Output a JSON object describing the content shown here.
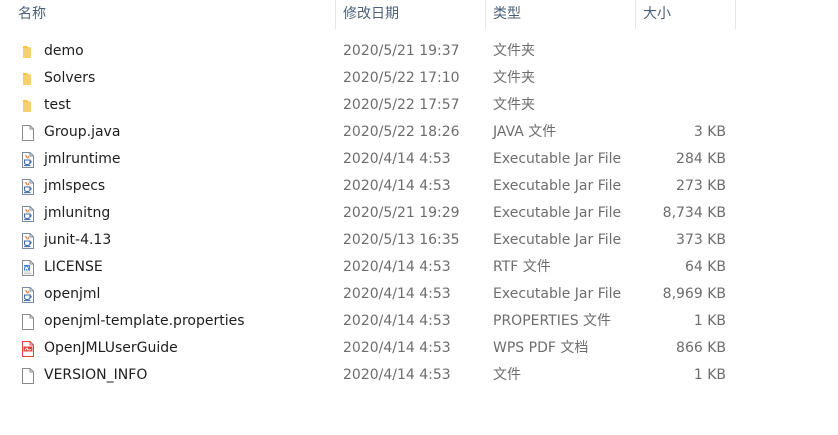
{
  "columns": {
    "name": "名称",
    "date": "修改日期",
    "type": "类型",
    "size": "大小"
  },
  "sort_indicator": "^",
  "files": [
    {
      "name": "demo",
      "date": "2020/5/21 19:37",
      "type": "文件夹",
      "size": "",
      "icon": "folder-icon"
    },
    {
      "name": "Solvers",
      "date": "2020/5/22 17:10",
      "type": "文件夹",
      "size": "",
      "icon": "folder-icon"
    },
    {
      "name": "test",
      "date": "2020/5/22 17:57",
      "type": "文件夹",
      "size": "",
      "icon": "folder-icon"
    },
    {
      "name": "Group.java",
      "date": "2020/5/22 18:26",
      "type": "JAVA 文件",
      "size": "3 KB",
      "icon": "blank-file-icon"
    },
    {
      "name": "jmlruntime",
      "date": "2020/4/14 4:53",
      "type": "Executable Jar File",
      "size": "284 KB",
      "icon": "java-jar-icon"
    },
    {
      "name": "jmlspecs",
      "date": "2020/4/14 4:53",
      "type": "Executable Jar File",
      "size": "273 KB",
      "icon": "java-jar-icon"
    },
    {
      "name": "jmlunitng",
      "date": "2020/5/21 19:29",
      "type": "Executable Jar File",
      "size": "8,734 KB",
      "icon": "java-jar-icon"
    },
    {
      "name": "junit-4.13",
      "date": "2020/5/13 16:35",
      "type": "Executable Jar File",
      "size": "373 KB",
      "icon": "java-jar-icon"
    },
    {
      "name": "LICENSE",
      "date": "2020/4/14 4:53",
      "type": "RTF 文件",
      "size": "64 KB",
      "icon": "rtf-document-icon"
    },
    {
      "name": "openjml",
      "date": "2020/4/14 4:53",
      "type": "Executable Jar File",
      "size": "8,969 KB",
      "icon": "java-jar-icon"
    },
    {
      "name": "openjml-template.properties",
      "date": "2020/4/14 4:53",
      "type": "PROPERTIES 文件",
      "size": "1 KB",
      "icon": "blank-file-icon"
    },
    {
      "name": "OpenJMLUserGuide",
      "date": "2020/4/14 4:53",
      "type": "WPS PDF 文档",
      "size": "866 KB",
      "icon": "pdf-document-icon"
    },
    {
      "name": "VERSION_INFO",
      "date": "2020/4/14 4:53",
      "type": "文件",
      "size": "1 KB",
      "icon": "blank-file-icon"
    }
  ],
  "colors": {
    "folder": "#f5c342",
    "header_text": "#4c607a",
    "secondary_text": "#6d6d6d",
    "pdf_red": "#e8413c",
    "doc_blue": "#3f7fd3"
  }
}
